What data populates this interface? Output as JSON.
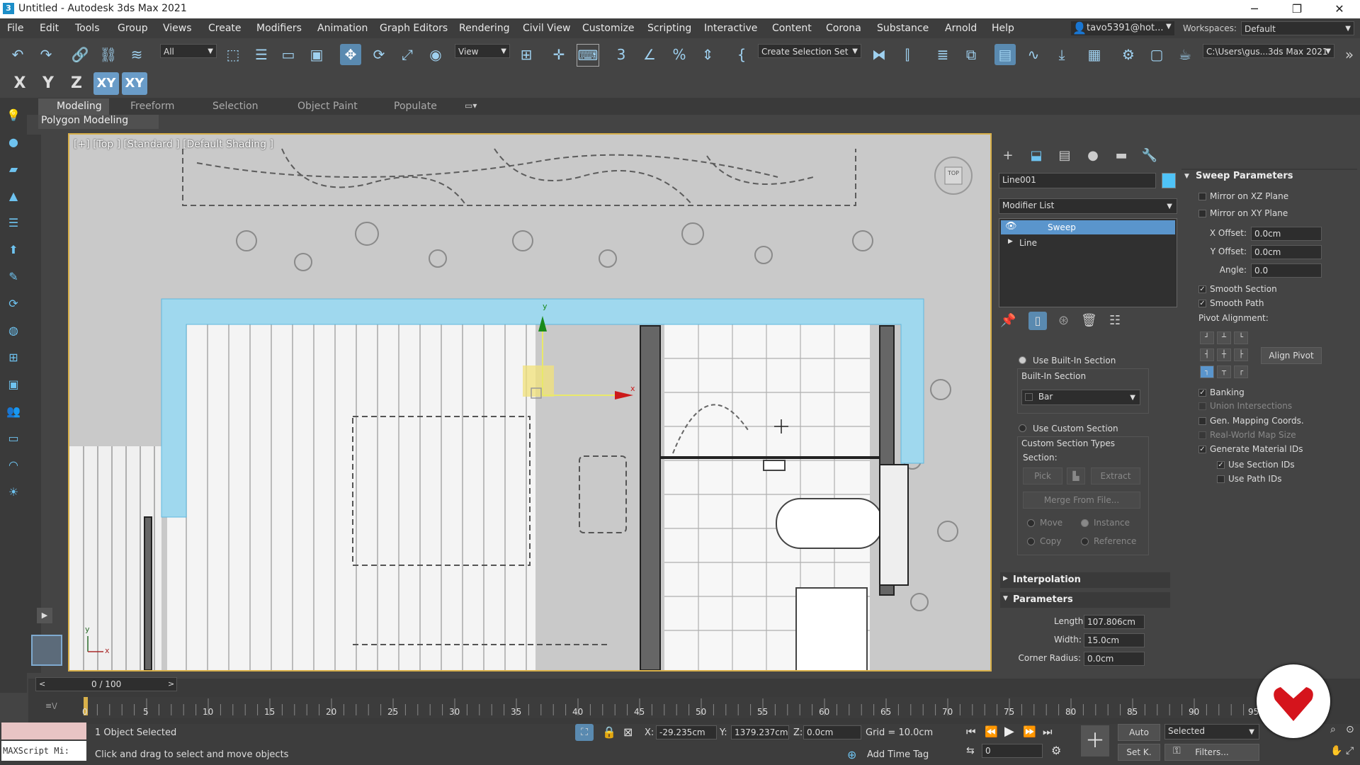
{
  "window": {
    "title": "Untitled - Autodesk 3ds Max 2021",
    "app_icon": "3",
    "min": "─",
    "max": "❐",
    "close": "✕"
  },
  "menu": [
    "File",
    "Edit",
    "Tools",
    "Group",
    "Views",
    "Create",
    "Modifiers",
    "Animation",
    "Graph Editors",
    "Rendering",
    "Civil View",
    "Customize",
    "Scripting",
    "Interactive",
    "Content",
    "Corona",
    "Substance",
    "Arnold",
    "Help"
  ],
  "account": {
    "user": "tavo5391@hot...",
    "workspaces_label": "Workspaces:",
    "workspace": "Default"
  },
  "toolbar": {
    "selection_filter": "All",
    "ref_coord": "View",
    "named_selection": "Create Selection Set",
    "project_path": "C:\\Users\\gus...3ds Max 2021"
  },
  "axis_constraints": [
    "X",
    "Y",
    "Z",
    "XY",
    "XY"
  ],
  "ribbon": {
    "tabs": [
      "Modeling",
      "Freeform",
      "Selection",
      "Object Paint",
      "Populate"
    ],
    "active": "Modeling",
    "panel": "Polygon Modeling"
  },
  "viewport": {
    "label": "[+] [Top ] [Standard ] [Default Shading ]",
    "viewcube": "TOP",
    "gizmo_x": "x",
    "gizmo_y": "y",
    "axis_x": "x",
    "axis_y": "y"
  },
  "command_panel": {
    "object_name": "Line001",
    "object_color": "#4fc3f7",
    "modifier_list": "Modifier List",
    "stack": [
      "Sweep",
      "Line"
    ],
    "section_type": {
      "use_builtin": "Use Built-In Section",
      "builtin_header": "Built-In Section",
      "builtin_value": "Bar",
      "use_custom": "Use Custom Section",
      "custom_header": "Custom Section Types",
      "section_label": "Section:",
      "pick": "Pick",
      "extract": "Extract",
      "merge": "Merge From File...",
      "move": "Move",
      "instance": "Instance",
      "copy": "Copy",
      "reference": "Reference"
    },
    "rollouts": {
      "interpolation": "Interpolation",
      "parameters": "Parameters"
    },
    "parameters": {
      "length_label": "Length:",
      "length": "107.806cm",
      "width_label": "Width:",
      "width": "15.0cm",
      "corner_label": "Corner Radius:",
      "corner": "0.0cm"
    },
    "sweep": {
      "header": "Sweep Parameters",
      "mirror_xz": "Mirror on XZ Plane",
      "mirror_xy": "Mirror on XY Plane",
      "x_offset_label": "X Offset:",
      "x_offset": "0.0cm",
      "y_offset_label": "Y Offset:",
      "y_offset": "0.0cm",
      "angle_label": "Angle:",
      "angle": "0.0",
      "smooth_section": "Smooth Section",
      "smooth_path": "Smooth Path",
      "pivot_alignment": "Pivot Alignment:",
      "align_pivot": "Align Pivot",
      "banking": "Banking",
      "union": "Union Intersections",
      "gen_mapping": "Gen. Mapping Coords.",
      "real_world": "Real-World Map Size",
      "gen_material": "Generate Material IDs",
      "use_section_ids": "Use Section IDs",
      "use_path_ids": "Use Path IDs"
    }
  },
  "timeline": {
    "frame": "0 / 100",
    "ticks": [
      "0",
      "5",
      "10",
      "15",
      "20",
      "25",
      "30",
      "35",
      "40",
      "45",
      "50",
      "55",
      "60",
      "65",
      "70",
      "75",
      "80",
      "85",
      "90",
      "95"
    ]
  },
  "status": {
    "maxscript": "MAXScript Mi:",
    "selected": "1 Object Selected",
    "prompt": "Click and drag to select and move objects",
    "x_label": "X:",
    "x": "-29.235cm",
    "y_label": "Y:",
    "y": "1379.237cm",
    "z_label": "Z:",
    "z": "0.0cm",
    "grid": "Grid = 10.0cm",
    "add_time_tag": "Add Time Tag",
    "auto": "Auto",
    "set_key": "Set K.",
    "selected_set": "Selected",
    "filters": "Filters...",
    "frame_field": "0"
  }
}
